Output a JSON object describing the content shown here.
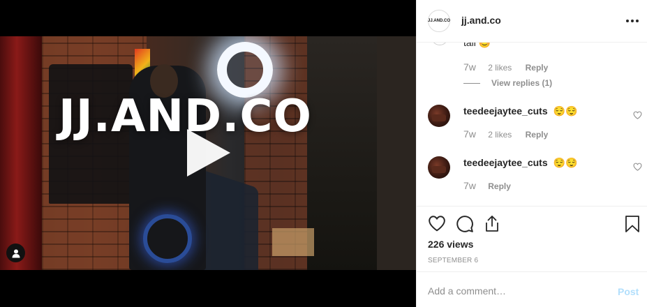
{
  "media": {
    "watermark_text": "JJ.AND.CO",
    "icons": {
      "play": "play-icon",
      "user_tag": "user-tag-icon"
    }
  },
  "header": {
    "avatar_text": "JJ.AND.CO",
    "username": "jj.and.co",
    "more_icon": "more-options-icon"
  },
  "comments": {
    "partial": {
      "text": "tall 😊",
      "time": "7w",
      "likes": "2 likes",
      "reply": "Reply",
      "view_replies": "View replies (1)"
    },
    "items": [
      {
        "username": "teedeejaytee_cuts",
        "text": "😌😌",
        "time": "7w",
        "likes": "2 likes",
        "reply": "Reply"
      },
      {
        "username": "teedeejaytee_cuts",
        "text": "😌😌",
        "time": "7w",
        "likes": "",
        "reply": "Reply"
      }
    ]
  },
  "actions": {
    "icons": [
      "heart-icon",
      "comment-icon",
      "share-icon",
      "bookmark-icon"
    ],
    "views": "226 views",
    "date": "SEPTEMBER 6"
  },
  "add_comment": {
    "placeholder": "Add a comment…",
    "post_label": "Post"
  },
  "colors": {
    "text": "#262626",
    "muted": "#8e8e8e",
    "post_disabled": "#b2dffc",
    "divider": "#efefef"
  }
}
